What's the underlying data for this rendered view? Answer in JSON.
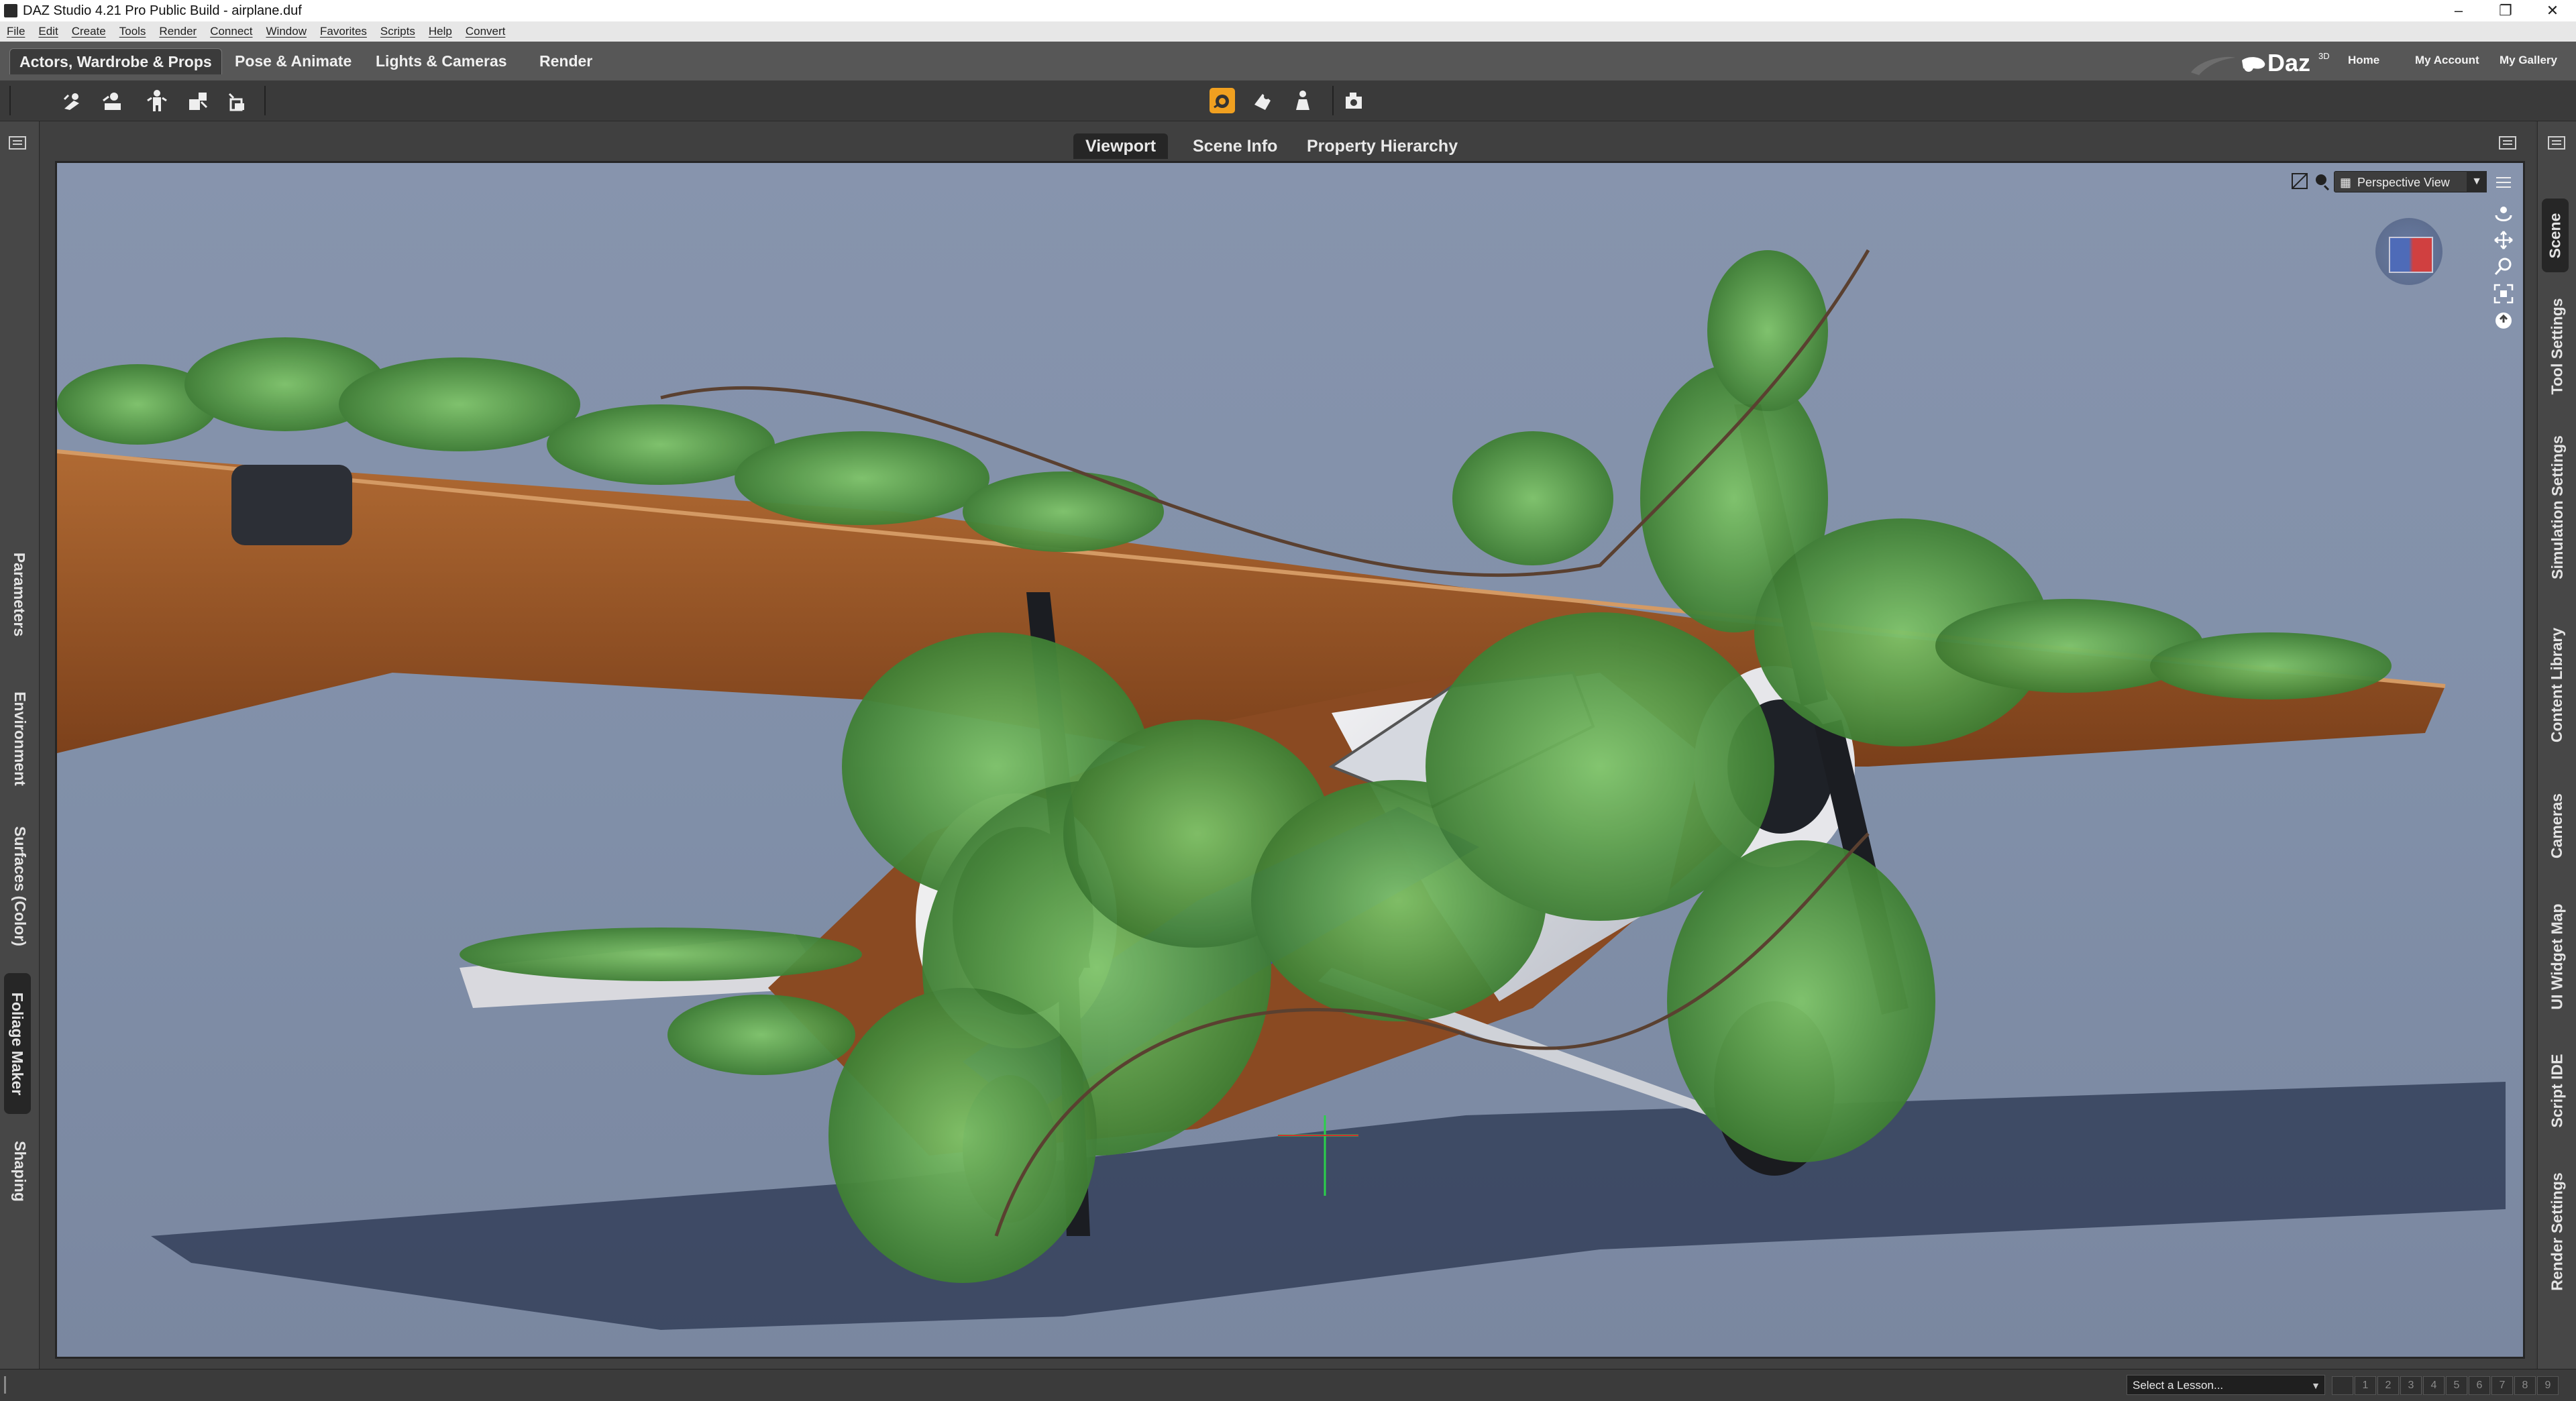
{
  "window": {
    "title": "DAZ Studio 4.21 Pro Public Build - airplane.duf",
    "controls": [
      "minimize",
      "restore",
      "close"
    ]
  },
  "menu": {
    "items": [
      "File",
      "Edit",
      "Create",
      "Tools",
      "Render",
      "Connect",
      "Window",
      "Favorites",
      "Scripts",
      "Help",
      "Convert"
    ]
  },
  "rooms": {
    "tabs": [
      "Actors, Wardrobe & Props",
      "Pose & Animate",
      "Lights & Cameras",
      "Render"
    ],
    "active": "Actors, Wardrobe & Props",
    "brand": "Daz",
    "brand_suffix": "3D",
    "links": [
      "Home",
      "My Account",
      "My Gallery"
    ]
  },
  "viewport_tabs": {
    "tabs": [
      "Viewport",
      "Scene Info",
      "Property Hierarchy"
    ],
    "active": "Viewport"
  },
  "viewport": {
    "camera_select": "Perspective View",
    "scene_description_icons": [
      "airplane",
      "vines"
    ]
  },
  "left_panes": [
    "Parameters",
    "Environment",
    "Surfaces (Color)",
    "Foliage Maker",
    "Shaping"
  ],
  "left_active": "Foliage Maker",
  "right_panes": [
    "Scene",
    "Tool Settings",
    "Simulation Settings",
    "Content Library",
    "Cameras",
    "UI Widget Map",
    "Script IDE",
    "Render Settings"
  ],
  "right_active": "Scene",
  "status": {
    "lesson_placeholder": "Select a Lesson...",
    "steps": [
      "1",
      "2",
      "3",
      "4",
      "5",
      "6",
      "7",
      "8",
      "9"
    ]
  },
  "colors": {
    "accent_orange": "#f0a020",
    "viewport_bg": "#8190a9",
    "panel_bg": "#474747"
  }
}
